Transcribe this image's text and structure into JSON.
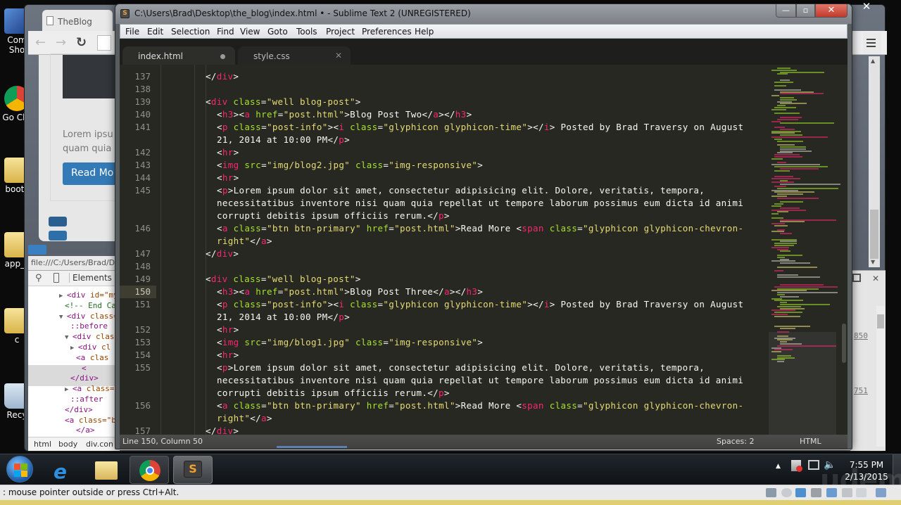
{
  "desktop": {
    "icons": [
      {
        "label": "Com Sho",
        "name": "computer-shortcut"
      },
      {
        "label": "Go Chr",
        "name": "google-chrome-shortcut"
      },
      {
        "label": "boots",
        "name": "bootstrap-folder"
      },
      {
        "label": "app_s",
        "name": "app-folder"
      },
      {
        "label": "c",
        "name": "c-folder"
      },
      {
        "label": "Recy",
        "name": "recycle-bin"
      }
    ]
  },
  "chrome": {
    "tab_title": "TheBlog",
    "page": {
      "lorem_line1": "Lorem ipsu",
      "lorem_line2": "quam quia",
      "read_more": "Read Mo"
    },
    "status_url": "file:///C:/Users/Brad/D",
    "devtools": {
      "tab_elements": "Elements",
      "tree": [
        {
          "indent": 0,
          "tri": "▶",
          "html": "div",
          "rest": " id=\"my"
        },
        {
          "indent": 1,
          "comment": "<!-- End Ca"
        },
        {
          "indent": 0,
          "tri": "▼",
          "html": "div",
          "rest": " class="
        },
        {
          "indent": 2,
          "pseudo": "::before"
        },
        {
          "indent": 1,
          "tri": "▼",
          "html": "div",
          "rest": " clas"
        },
        {
          "indent": 2,
          "tri": "▶",
          "html": "div",
          "rest": " cl"
        },
        {
          "indent": 3,
          "html": "a",
          "rest": " clas"
        },
        {
          "indent": 4,
          "close": "<"
        },
        {
          "indent": 2,
          "close": "</div>"
        },
        {
          "indent": 1,
          "tri": "▶",
          "html": "a",
          "rest": " class="
        },
        {
          "indent": 2,
          "pseudo": "::after"
        },
        {
          "indent": 1,
          "close": "</div>"
        },
        {
          "indent": 1,
          "html": "a",
          "rest": " class=\"b"
        },
        {
          "indent": 3,
          "close": "</a>"
        }
      ],
      "breadcrumbs": [
        "html",
        "body",
        "div.con"
      ],
      "right_numbers": [
        "850",
        "751"
      ]
    }
  },
  "sublime": {
    "window_title": "C:\\Users\\Brad\\Desktop\\the_blog\\index.html • - Sublime Text 2 (UNREGISTERED)",
    "menu": [
      "File",
      "Edit",
      "Selection",
      "Find",
      "View",
      "Goto",
      "Tools",
      "Project",
      "Preferences",
      "Help"
    ],
    "tabs": [
      {
        "label": "index.html",
        "modified": true,
        "active": true
      },
      {
        "label": "style.css",
        "modified": false,
        "active": false
      }
    ],
    "active_line": 150,
    "code_lines": [
      {
        "n": "137",
        "indent": 2,
        "tokens": [
          [
            "p",
            "</"
          ],
          [
            "t",
            "div"
          ],
          [
            "p",
            ">"
          ]
        ]
      },
      {
        "n": "138",
        "indent": 0,
        "tokens": []
      },
      {
        "n": "139",
        "indent": 2,
        "tokens": [
          [
            "p",
            "<"
          ],
          [
            "t",
            "div"
          ],
          [
            "p",
            " "
          ],
          [
            "a",
            "class"
          ],
          [
            "p",
            "="
          ],
          [
            "s",
            "\"well blog-post\""
          ],
          [
            "p",
            ">"
          ]
        ]
      },
      {
        "n": "140",
        "indent": 3,
        "tokens": [
          [
            "p",
            "<"
          ],
          [
            "t",
            "h3"
          ],
          [
            "p",
            "><"
          ],
          [
            "t",
            "a"
          ],
          [
            "p",
            " "
          ],
          [
            "a",
            "href"
          ],
          [
            "p",
            "="
          ],
          [
            "s",
            "\"post.html\""
          ],
          [
            "p",
            ">Blog Post Two</"
          ],
          [
            "t",
            "a"
          ],
          [
            "p",
            "></"
          ],
          [
            "t",
            "h3"
          ],
          [
            "p",
            ">"
          ]
        ]
      },
      {
        "n": "141",
        "indent": 3,
        "tokens": [
          [
            "p",
            "<"
          ],
          [
            "t",
            "p"
          ],
          [
            "p",
            " "
          ],
          [
            "a",
            "class"
          ],
          [
            "p",
            "="
          ],
          [
            "s",
            "\"post-info\""
          ],
          [
            "p",
            "><"
          ],
          [
            "t",
            "i"
          ],
          [
            "p",
            " "
          ],
          [
            "a",
            "class"
          ],
          [
            "p",
            "="
          ],
          [
            "s",
            "\"glyphicon glyphicon-time\""
          ],
          [
            "p",
            "></"
          ],
          [
            "t",
            "i"
          ],
          [
            "p",
            "> Posted by Brad Traversy on August"
          ]
        ]
      },
      {
        "n": "",
        "indent": 3,
        "tokens": [
          [
            "p",
            "21, 2014 at 10:00 PM</"
          ],
          [
            "t",
            "p"
          ],
          [
            "p",
            ">"
          ]
        ]
      },
      {
        "n": "142",
        "indent": 3,
        "tokens": [
          [
            "p",
            "<"
          ],
          [
            "t",
            "hr"
          ],
          [
            "p",
            ">"
          ]
        ]
      },
      {
        "n": "143",
        "indent": 3,
        "tokens": [
          [
            "p",
            "<"
          ],
          [
            "t",
            "img"
          ],
          [
            "p",
            " "
          ],
          [
            "a",
            "src"
          ],
          [
            "p",
            "="
          ],
          [
            "s",
            "\"img/blog2.jpg\""
          ],
          [
            "p",
            " "
          ],
          [
            "a",
            "class"
          ],
          [
            "p",
            "="
          ],
          [
            "s",
            "\"img-responsive\""
          ],
          [
            "p",
            ">"
          ]
        ]
      },
      {
        "n": "144",
        "indent": 3,
        "tokens": [
          [
            "p",
            "<"
          ],
          [
            "t",
            "hr"
          ],
          [
            "p",
            ">"
          ]
        ]
      },
      {
        "n": "145",
        "indent": 3,
        "tokens": [
          [
            "p",
            "<"
          ],
          [
            "t",
            "p"
          ],
          [
            "p",
            ">Lorem ipsum dolor sit amet, consectetur adipisicing elit. Dolore, veritatis, tempora,"
          ]
        ]
      },
      {
        "n": "",
        "indent": 3,
        "tokens": [
          [
            "p",
            "necessitatibus inventore nisi quam quia repellat ut tempore laborum possimus eum dicta id animi"
          ]
        ]
      },
      {
        "n": "",
        "indent": 3,
        "tokens": [
          [
            "p",
            "corrupti debitis ipsum officiis rerum.</"
          ],
          [
            "t",
            "p"
          ],
          [
            "p",
            ">"
          ]
        ]
      },
      {
        "n": "146",
        "indent": 3,
        "tokens": [
          [
            "p",
            "<"
          ],
          [
            "t",
            "a"
          ],
          [
            "p",
            " "
          ],
          [
            "a",
            "class"
          ],
          [
            "p",
            "="
          ],
          [
            "s",
            "\"btn btn-primary\""
          ],
          [
            "p",
            " "
          ],
          [
            "a",
            "href"
          ],
          [
            "p",
            "="
          ],
          [
            "s",
            "\"post.html\""
          ],
          [
            "p",
            ">Read More <"
          ],
          [
            "t",
            "span"
          ],
          [
            "p",
            " "
          ],
          [
            "a",
            "class"
          ],
          [
            "p",
            "="
          ],
          [
            "s",
            "\"glyphicon glyphicon-chevron-"
          ]
        ]
      },
      {
        "n": "",
        "indent": 3,
        "tokens": [
          [
            "s",
            "right\""
          ],
          [
            "p",
            "</"
          ],
          [
            "t",
            "a"
          ],
          [
            "p",
            ">"
          ]
        ]
      },
      {
        "n": "147",
        "indent": 2,
        "tokens": [
          [
            "p",
            "</"
          ],
          [
            "t",
            "div"
          ],
          [
            "p",
            ">"
          ]
        ]
      },
      {
        "n": "148",
        "indent": 0,
        "tokens": []
      },
      {
        "n": "149",
        "indent": 2,
        "tokens": [
          [
            "p",
            "<"
          ],
          [
            "t",
            "div"
          ],
          [
            "p",
            " "
          ],
          [
            "a",
            "class"
          ],
          [
            "p",
            "="
          ],
          [
            "s",
            "\"well blog-post\""
          ],
          [
            "p",
            ">"
          ]
        ]
      },
      {
        "n": "150",
        "indent": 3,
        "tokens": [
          [
            "p",
            "<"
          ],
          [
            "t",
            "h3"
          ],
          [
            "p",
            "><"
          ],
          [
            "t",
            "a"
          ],
          [
            "p",
            " "
          ],
          [
            "a",
            "href"
          ],
          [
            "p",
            "="
          ],
          [
            "s",
            "\"post.html\""
          ],
          [
            "p",
            ">Blog Post Three</"
          ],
          [
            "t",
            "a"
          ],
          [
            "p",
            "></"
          ],
          [
            "t",
            "h3"
          ],
          [
            "p",
            ">"
          ]
        ]
      },
      {
        "n": "151",
        "indent": 3,
        "tokens": [
          [
            "p",
            "<"
          ],
          [
            "t",
            "p"
          ],
          [
            "p",
            " "
          ],
          [
            "a",
            "class"
          ],
          [
            "p",
            "="
          ],
          [
            "s",
            "\"post-info\""
          ],
          [
            "p",
            "><"
          ],
          [
            "t",
            "i"
          ],
          [
            "p",
            " "
          ],
          [
            "a",
            "class"
          ],
          [
            "p",
            "="
          ],
          [
            "s",
            "\"glyphicon glyphicon-time\""
          ],
          [
            "p",
            "></"
          ],
          [
            "t",
            "i"
          ],
          [
            "p",
            "> Posted by Brad Traversy on August"
          ]
        ]
      },
      {
        "n": "",
        "indent": 3,
        "tokens": [
          [
            "p",
            "21, 2014 at 10:00 PM</"
          ],
          [
            "t",
            "p"
          ],
          [
            "p",
            ">"
          ]
        ]
      },
      {
        "n": "152",
        "indent": 3,
        "tokens": [
          [
            "p",
            "<"
          ],
          [
            "t",
            "hr"
          ],
          [
            "p",
            ">"
          ]
        ]
      },
      {
        "n": "153",
        "indent": 3,
        "tokens": [
          [
            "p",
            "<"
          ],
          [
            "t",
            "img"
          ],
          [
            "p",
            " "
          ],
          [
            "a",
            "src"
          ],
          [
            "p",
            "="
          ],
          [
            "s",
            "\"img/blog1.jpg\""
          ],
          [
            "p",
            " "
          ],
          [
            "a",
            "class"
          ],
          [
            "p",
            "="
          ],
          [
            "s",
            "\"img-responsive\""
          ],
          [
            "p",
            ">"
          ]
        ]
      },
      {
        "n": "154",
        "indent": 3,
        "tokens": [
          [
            "p",
            "<"
          ],
          [
            "t",
            "hr"
          ],
          [
            "p",
            ">"
          ]
        ]
      },
      {
        "n": "155",
        "indent": 3,
        "tokens": [
          [
            "p",
            "<"
          ],
          [
            "t",
            "p"
          ],
          [
            "p",
            ">Lorem ipsum dolor sit amet, consectetur adipisicing elit. Dolore, veritatis, tempora,"
          ]
        ]
      },
      {
        "n": "",
        "indent": 3,
        "tokens": [
          [
            "p",
            "necessitatibus inventore nisi quam quia repellat ut tempore laborum possimus eum dicta id animi"
          ]
        ]
      },
      {
        "n": "",
        "indent": 3,
        "tokens": [
          [
            "p",
            "corrupti debitis ipsum officiis rerum.</"
          ],
          [
            "t",
            "p"
          ],
          [
            "p",
            ">"
          ]
        ]
      },
      {
        "n": "156",
        "indent": 3,
        "tokens": [
          [
            "p",
            "<"
          ],
          [
            "t",
            "a"
          ],
          [
            "p",
            " "
          ],
          [
            "a",
            "class"
          ],
          [
            "p",
            "="
          ],
          [
            "s",
            "\"btn btn-primary\""
          ],
          [
            "p",
            " "
          ],
          [
            "a",
            "href"
          ],
          [
            "p",
            "="
          ],
          [
            "s",
            "\"post.html\""
          ],
          [
            "p",
            ">Read More <"
          ],
          [
            "t",
            "span"
          ],
          [
            "p",
            " "
          ],
          [
            "a",
            "class"
          ],
          [
            "p",
            "="
          ],
          [
            "s",
            "\"glyphicon glyphicon-chevron-"
          ]
        ]
      },
      {
        "n": "",
        "indent": 3,
        "tokens": [
          [
            "s",
            "right\""
          ],
          [
            "p",
            "</"
          ],
          [
            "t",
            "a"
          ],
          [
            "p",
            ">"
          ]
        ]
      },
      {
        "n": "157",
        "indent": 2,
        "tokens": [
          [
            "p",
            "</"
          ],
          [
            "t",
            "div"
          ],
          [
            "p",
            ">"
          ]
        ]
      }
    ],
    "status": {
      "position": "Line 150, Column 50",
      "indentation": "Spaces: 2",
      "syntax": "HTML"
    },
    "colors": {
      "background": "#272822",
      "tag": "#f92672",
      "attribute": "#a6e22e",
      "string": "#e6db74",
      "text": "#f8f8f2",
      "line_number": "#8f908a"
    }
  },
  "taskbar": {
    "apps": [
      "start",
      "internet-explorer",
      "file-explorer",
      "google-chrome",
      "sublime-text"
    ],
    "clock_time": "7:55 PM",
    "clock_date": "2/13/2015"
  },
  "vm": {
    "message": ": mouse pointer outside or press Ctrl+Alt."
  },
  "watermark": "udemy"
}
